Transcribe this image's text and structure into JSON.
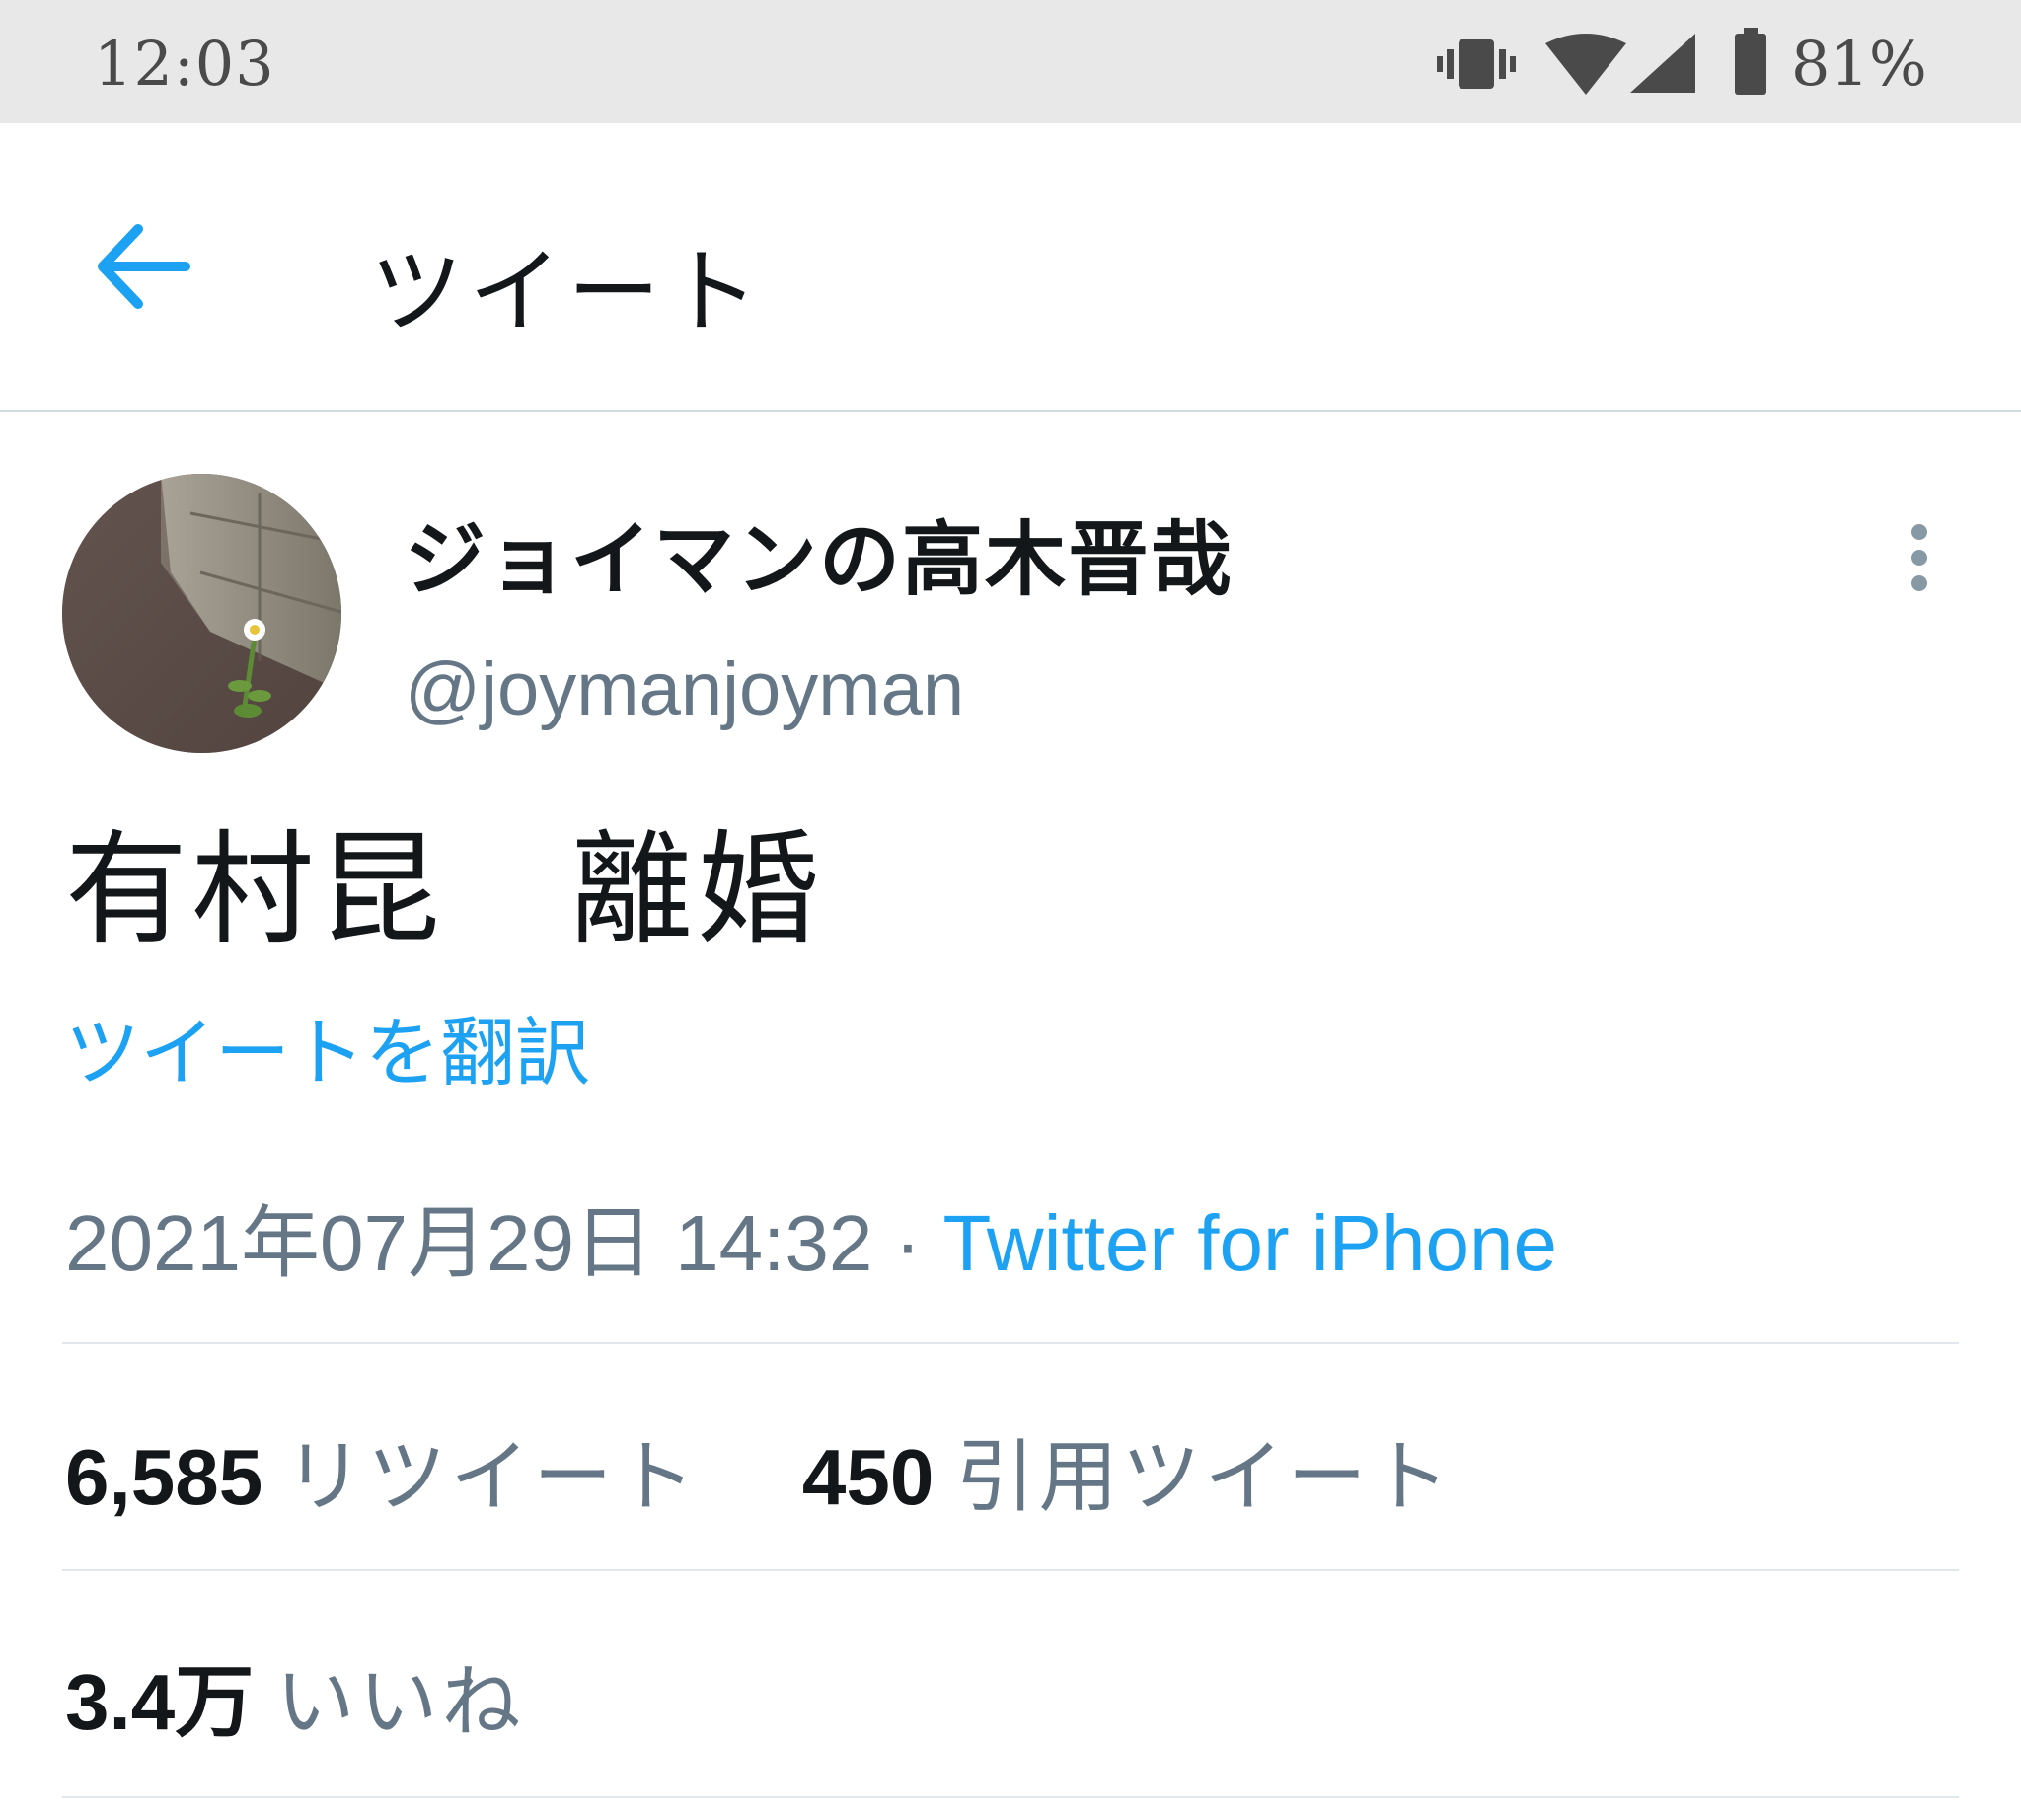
{
  "status_bar": {
    "time": "12:03",
    "battery_percent": "81%",
    "icons": [
      "vibrate-icon",
      "wifi-icon",
      "cell-signal-icon",
      "battery-icon"
    ]
  },
  "header": {
    "back_icon": "arrow-left-icon",
    "title": "ツイート"
  },
  "tweet": {
    "author": {
      "display_name": "ジョイマンの高木晋哉",
      "handle": "@joymanjoyman"
    },
    "text": "有村昆　離婚",
    "translate_label": "ツイートを翻訳",
    "date": "2021年07月29日 14:32",
    "separator": "·",
    "source": "Twitter for iPhone",
    "stats": {
      "retweets_count": "6,585",
      "retweets_label": "リツイート",
      "quotes_count": "450",
      "quotes_label": "引用ツイート",
      "likes_count": "3.4万",
      "likes_label": "いいね"
    }
  },
  "colors": {
    "accent": "#1da1f2",
    "text_primary": "#14171a",
    "text_secondary": "#657786",
    "divider": "#e1e8ed",
    "status_bar_bg": "#e8e8e8"
  }
}
